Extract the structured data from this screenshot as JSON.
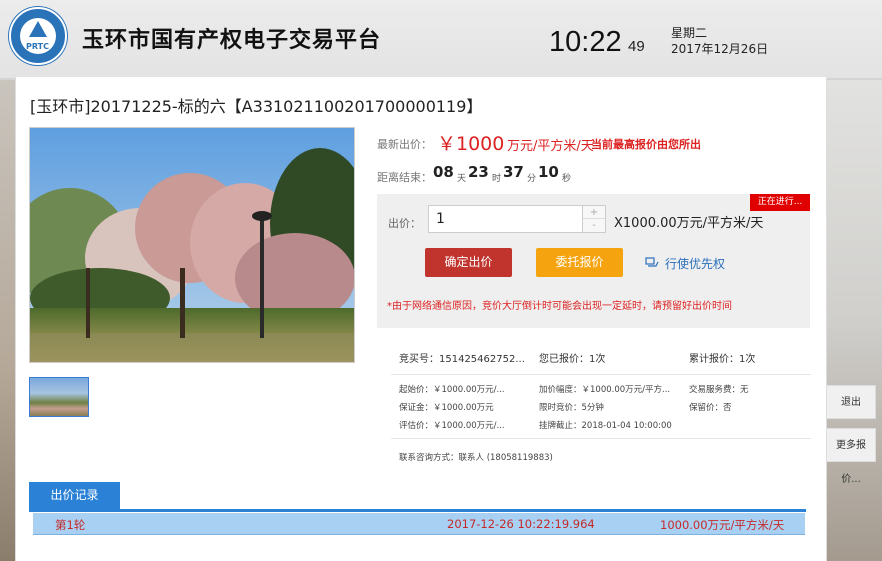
{
  "header": {
    "logo_text": "PRTC",
    "site_title": "玉环市国有产权电子交易平台",
    "clock_hm": "10:22",
    "clock_sec": "49",
    "weekday": "星期二",
    "date": "2017年12月26日"
  },
  "lot": {
    "title": "[玉环市]20171225-标的六【A331021100201700000119】"
  },
  "price": {
    "label": "最新出价：",
    "value": "￥1000",
    "unit": "万元/平方米/天",
    "note": "当前最高报价由您所出"
  },
  "countdown": {
    "label": "距离结束：",
    "days": "08",
    "days_unit": "天",
    "hours": "23",
    "hours_unit": "时",
    "minutes": "37",
    "minutes_unit": "分",
    "seconds": "10",
    "seconds_unit": "秒"
  },
  "bid": {
    "status": "正在进行...",
    "label": "出价：",
    "input_value": "1",
    "stepper_up": "+",
    "stepper_down": "-",
    "multiplier": "X1000.00万元/平方米/天",
    "confirm_label": "确定出价",
    "entrust_label": "委托报价",
    "priority_label": "行使优先权",
    "warning": "*由于网络通信原因，竞价大厅倒计时可能会出现一定延时，请预留好出价时间"
  },
  "stats": {
    "bidder_no": "竞买号：151425462752...",
    "my_bids": "您已报价：1次",
    "total_bids": "累计报价：1次"
  },
  "details": {
    "start_price": "起始价：￥1000.00万元/...",
    "increment": "加价幅度：￥1000.00万元/平方...",
    "service_fee": "交易服务费：无",
    "deposit": "保证金：￥1000.00万元",
    "time_limit": "限时竞价：5分钟",
    "reserve": "保留价：否",
    "appraisal": "评估价：￥1000.00万元/...",
    "deadline": "挂牌截止：2018-01-04 10:00:00"
  },
  "contact": "联系咨询方式：联系人 (18058119883)",
  "records": {
    "tab_label": "出价记录",
    "rows": [
      {
        "round": "第1轮",
        "time": "2017-12-26 10:22:19.964",
        "price": "1000.00万元/平方米/天"
      }
    ]
  },
  "side": {
    "logout": "退出",
    "more_bids": "更多报价..."
  }
}
